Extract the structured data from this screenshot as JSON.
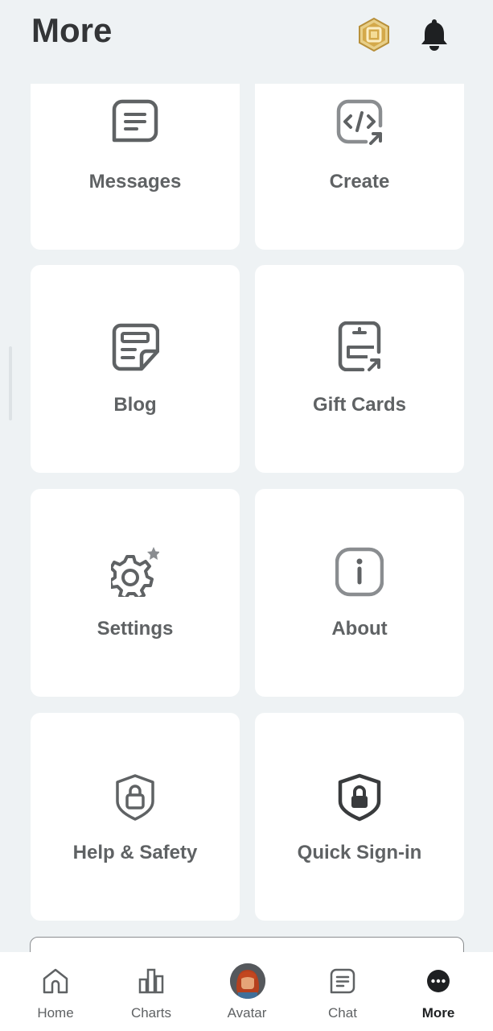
{
  "header": {
    "title": "More",
    "robux_icon": "robux-icon",
    "bell_icon": "bell-icon"
  },
  "tiles": [
    {
      "label": "Messages",
      "icon": "messages-icon"
    },
    {
      "label": "Create",
      "icon": "create-code-icon"
    },
    {
      "label": "Blog",
      "icon": "blog-icon"
    },
    {
      "label": "Gift Cards",
      "icon": "gift-card-icon"
    },
    {
      "label": "Settings",
      "icon": "settings-gear-icon"
    },
    {
      "label": "About",
      "icon": "info-icon"
    },
    {
      "label": "Help & Safety",
      "icon": "shield-lock-outline-icon"
    },
    {
      "label": "Quick Sign-in",
      "icon": "shield-lock-filled-icon"
    }
  ],
  "bottom_nav": [
    {
      "label": "Home",
      "icon": "home-icon",
      "active": false
    },
    {
      "label": "Charts",
      "icon": "charts-icon",
      "active": false
    },
    {
      "label": "Avatar",
      "icon": "avatar-icon",
      "active": false
    },
    {
      "label": "Chat",
      "icon": "chat-icon",
      "active": false
    },
    {
      "label": "More",
      "icon": "more-dots-icon",
      "active": true
    }
  ],
  "colors": {
    "background": "#eef2f4",
    "tile": "#ffffff",
    "icon": "#5f6264",
    "robux_gold": "#c9a24a",
    "active_nav": "#1e2022"
  }
}
